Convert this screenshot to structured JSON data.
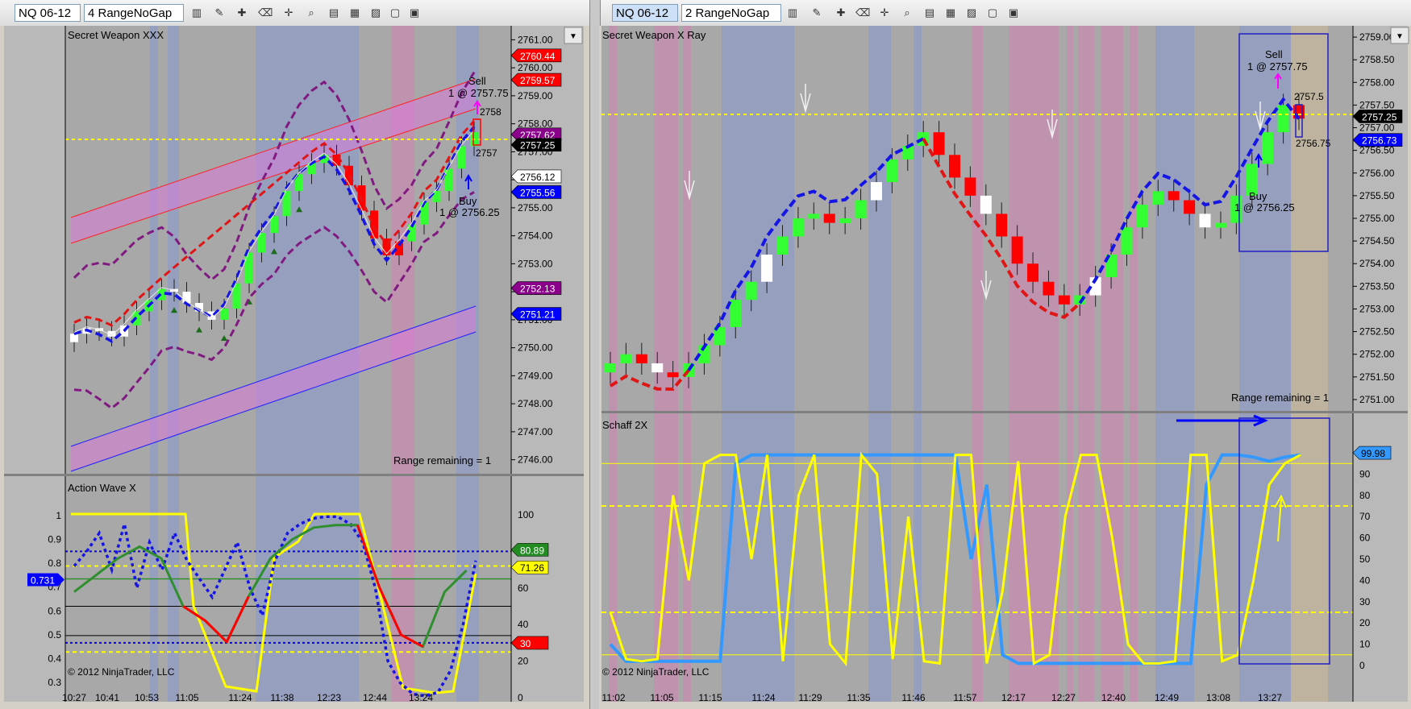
{
  "left_window": {
    "instrument": "NQ 06-12",
    "period": "4 RangeNoGap",
    "price_panel": {
      "title": "Secret Weapon XXX",
      "range_remaining": "Range remaining = 1",
      "copyright": "© 2012 NinjaTrader, LLC",
      "axis_labels": [
        "2761.00",
        "2760.00",
        "2759.00",
        "2758.00",
        "2757.00",
        "2756.00",
        "2755.00",
        "2754.00",
        "2753.00",
        "2752.00",
        "2751.00",
        "2750.00",
        "2749.00",
        "2748.00",
        "2747.00",
        "2746.00"
      ],
      "price_tags": [
        {
          "text": "2760.44",
          "value": 2760.44,
          "color": "#ff0000"
        },
        {
          "text": "2759.57",
          "value": 2759.57,
          "color": "#ff0000"
        },
        {
          "text": "2757.62",
          "value": 2757.62,
          "color": "#8b008b"
        },
        {
          "text": "2757.25",
          "value": 2757.25,
          "color": "#000000"
        },
        {
          "text": "2756.12",
          "value": 2756.12,
          "color": "#ffffff"
        },
        {
          "text": "2755.56",
          "value": 2755.56,
          "color": "#0000ff"
        },
        {
          "text": "2752.13",
          "value": 2752.13,
          "color": "#8b008b"
        },
        {
          "text": "2751.21",
          "value": 2751.21,
          "color": "#0000ff"
        }
      ],
      "annotations": {
        "sell_label": "Sell",
        "sell_fill": "1 @ 2757.75",
        "buy_label": "Buy",
        "buy_fill": "1 @ 2756.25",
        "level_high": "2758",
        "level_low": "2757"
      }
    },
    "osc_panel": {
      "title": "Action Wave X",
      "left_axis": [
        "1",
        "0.9",
        "0.8",
        "0.7",
        "0.6",
        "0.5",
        "0.4",
        "0.3"
      ],
      "right_axis": [
        "100",
        "80",
        "60",
        "40",
        "20",
        "0"
      ],
      "tags": [
        {
          "text": "80.89",
          "color": "#228b22"
        },
        {
          "text": "71.26",
          "color": "#ffff00"
        },
        {
          "text": "30",
          "color": "#ff0000"
        },
        {
          "text": "0.731",
          "color": "#0000ff"
        }
      ]
    },
    "time_axis": [
      "10:27",
      "10:41",
      "10:53",
      "11:05",
      "11:24",
      "11:38",
      "12:23",
      "12:44",
      "13:24"
    ]
  },
  "right_window": {
    "instrument": "NQ 06-12",
    "period": "2 RangeNoGap",
    "price_panel": {
      "title": "Secret Weapon  X Ray",
      "range_remaining": "Range remaining = 1",
      "axis_labels": [
        "2759.00",
        "2758.50",
        "2758.00",
        "2757.50",
        "2757.00",
        "2756.50",
        "2756.00",
        "2755.50",
        "2755.00",
        "2754.50",
        "2754.00",
        "2753.50",
        "2753.00",
        "2752.50",
        "2752.00",
        "2751.50",
        "2751.00"
      ],
      "price_tags": [
        {
          "text": "2757.25",
          "value": 2757.25,
          "color": "#000000"
        },
        {
          "text": "2756.73",
          "value": 2756.73,
          "color": "#0000ff"
        }
      ],
      "annotations": {
        "sell_label": "Sell",
        "sell_fill": "1 @ 2757.75",
        "buy_label": "Buy",
        "buy_fill": "1 @ 2756.25",
        "level_high": "2757.5",
        "level_low": "2756.75"
      }
    },
    "osc_panel": {
      "title": "Schaff 2X",
      "copyright": "© 2012 NinjaTrader, LLC",
      "right_axis": [
        "90",
        "80",
        "70",
        "60",
        "50",
        "40",
        "30",
        "20",
        "10",
        "0"
      ],
      "tag": {
        "text": "99.98",
        "color": "#3399ff"
      }
    },
    "time_axis": [
      "11:02",
      "11:05",
      "11:15",
      "11:24",
      "11:29",
      "11:35",
      "11:46",
      "11:57",
      "12:17",
      "12:27",
      "12:40",
      "12:49",
      "13:08",
      "13:27"
    ]
  },
  "chart_data": [
    {
      "type": "candlestick",
      "panel": "left-price",
      "ylim": [
        2745.5,
        2761.5
      ],
      "series": [
        {
          "name": "closes",
          "values": [
            2750.5,
            2750.7,
            2750.6,
            2750.4,
            2750.8,
            2751.3,
            2751.7,
            2752.1,
            2752.0,
            2751.6,
            2751.3,
            2751.0,
            2751.4,
            2752.3,
            2753.4,
            2754.1,
            2754.7,
            2755.6,
            2756.2,
            2756.6,
            2756.9,
            2756.5,
            2755.8,
            2754.9,
            2753.9,
            2753.3,
            2753.8,
            2754.4,
            2755.2,
            2755.6,
            2756.4,
            2757.2,
            2757.7
          ]
        }
      ]
    },
    {
      "type": "line",
      "panel": "left-osc",
      "ylim": [
        0,
        100
      ],
      "series": [
        {
          "values": [
            72,
            80,
            90,
            70,
            95,
            60,
            85,
            70,
            90,
            75,
            65,
            55,
            70,
            85,
            60,
            45,
            75,
            90,
            95,
            98,
            99,
            99,
            95,
            85,
            60,
            20,
            8,
            2,
            1,
            3,
            15,
            40,
            75
          ]
        },
        {
          "values": [
            0.68,
            0.75,
            0.82,
            0.87,
            0.82,
            0.62,
            0.56,
            0.47,
            0.66,
            0.82,
            0.9,
            0.95,
            0.96,
            0.96,
            0.7,
            0.5,
            0.45,
            0.68,
            0.77
          ]
        }
      ]
    },
    {
      "type": "candlestick",
      "panel": "right-price",
      "ylim": [
        2750.75,
        2759.25
      ],
      "series": [
        {
          "name": "closes",
          "values": [
            2751.8,
            2752.0,
            2751.8,
            2751.6,
            2751.5,
            2751.8,
            2752.2,
            2752.6,
            2753.2,
            2753.6,
            2754.2,
            2754.6,
            2755.0,
            2755.1,
            2754.9,
            2755.0,
            2755.4,
            2755.8,
            2756.3,
            2756.6,
            2756.9,
            2756.4,
            2755.9,
            2755.5,
            2755.1,
            2754.6,
            2754.0,
            2753.6,
            2753.3,
            2753.1,
            2753.3,
            2753.7,
            2754.2,
            2754.8,
            2755.3,
            2755.6,
            2755.4,
            2755.1,
            2754.8,
            2754.9,
            2755.5,
            2756.2,
            2756.9,
            2757.5,
            2757.2
          ]
        }
      ]
    },
    {
      "type": "line",
      "panel": "right-osc",
      "ylim": [
        0,
        100
      ],
      "series": [
        {
          "values": [
            10,
            2,
            2,
            2,
            2,
            2,
            2,
            2,
            95,
            99,
            99,
            99,
            99,
            99,
            99,
            99,
            99,
            99,
            99,
            99,
            99,
            99,
            99,
            50,
            85,
            5,
            1,
            1,
            1,
            1,
            1,
            1,
            1,
            1,
            1,
            1,
            1,
            1,
            85,
            99,
            99,
            98,
            96,
            98,
            99
          ]
        },
        {
          "values": [
            25,
            3,
            2,
            3,
            80,
            40,
            95,
            99,
            99,
            50,
            99,
            2,
            80,
            99,
            10,
            1,
            99,
            90,
            3,
            70,
            2,
            1,
            99,
            99,
            1,
            35,
            96,
            1,
            5,
            70,
            99,
            99,
            60,
            10,
            1,
            1,
            2,
            99,
            99,
            2,
            5,
            40,
            85,
            95,
            99
          ]
        }
      ]
    }
  ]
}
